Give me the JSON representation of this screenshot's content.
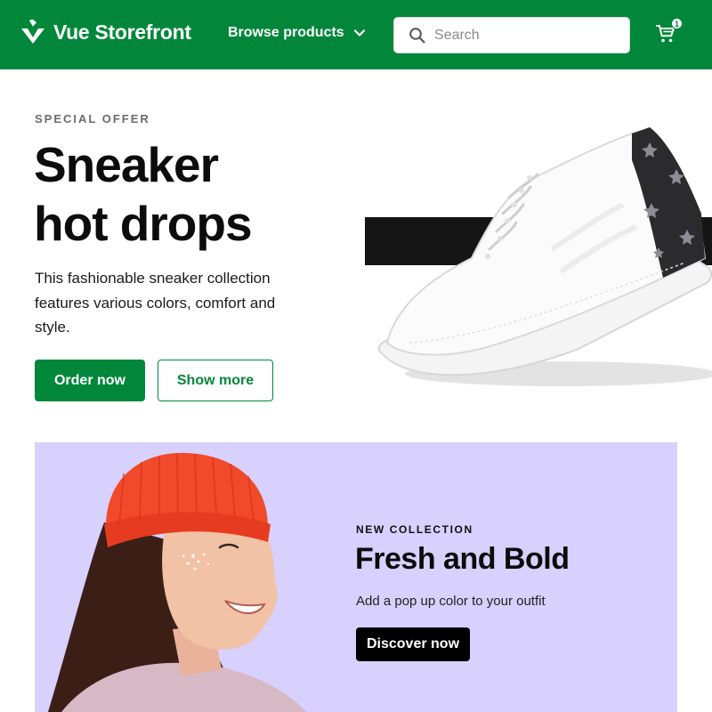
{
  "header": {
    "logo_text": "Vue Storefront",
    "logo_icon": "checkmark-logo-icon",
    "browse_label": "Browse products",
    "search_placeholder": "Search",
    "search_value": "",
    "cart_count": "1",
    "brand_color": "#02873a"
  },
  "hero": {
    "eyebrow": "SPECIAL OFFER",
    "title_line1": "Sneaker",
    "title_line2": "hot drops",
    "description": "This fashionable sneaker collection features various colors, comfort and style.",
    "primary_button": "Order now",
    "secondary_button": "Show more"
  },
  "promo": {
    "eyebrow": "NEW COLLECTION",
    "title": "Fresh and Bold",
    "description": "Add a pop up color to your outfit",
    "button": "Discover now",
    "background_color": "#d8d0fd"
  }
}
